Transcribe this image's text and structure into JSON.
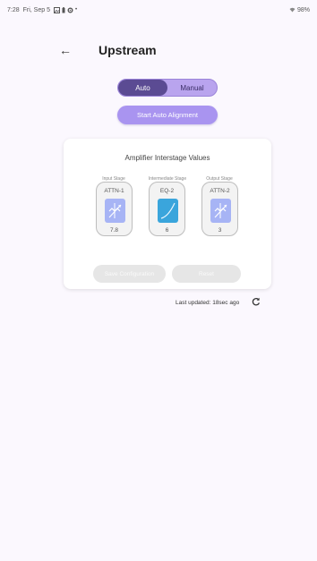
{
  "status_bar": {
    "time": "7:28",
    "date": "Fri, Sep 5",
    "battery": "98%"
  },
  "header": {
    "back_icon": "←",
    "title": "Upstream"
  },
  "mode_toggle": {
    "options": [
      "Auto",
      "Manual"
    ],
    "selected": "Auto"
  },
  "auto_alignment_button": "Start Auto Alignment",
  "card": {
    "title": "Amplifier Interstage Values",
    "stages": [
      {
        "label": "Input Stage",
        "name": "ATTN-1",
        "value": "7.8",
        "icon": "attenuator-icon",
        "icon_color": "#a7b4f5"
      },
      {
        "label": "Intermediate Stage",
        "name": "EQ-2",
        "value": "6",
        "icon": "equalizer-curve-icon",
        "icon_color": "#3aa5dc"
      },
      {
        "label": "Output Stage",
        "name": "ATTN-2",
        "value": "3",
        "icon": "attenuator-icon",
        "icon_color": "#a7b4f5"
      }
    ],
    "save_button": "Save Configuration",
    "reset_button": "Reset"
  },
  "footer": {
    "last_updated": "Last updated: 18sec ago",
    "refresh_icon": "refresh-icon"
  },
  "colors": {
    "background": "#fbf8fe",
    "segment_active": "#5b4b93",
    "segment_inactive": "#b9a4ee",
    "primary_button": "#a994f0",
    "disabled_button": "#e6e6e6"
  }
}
